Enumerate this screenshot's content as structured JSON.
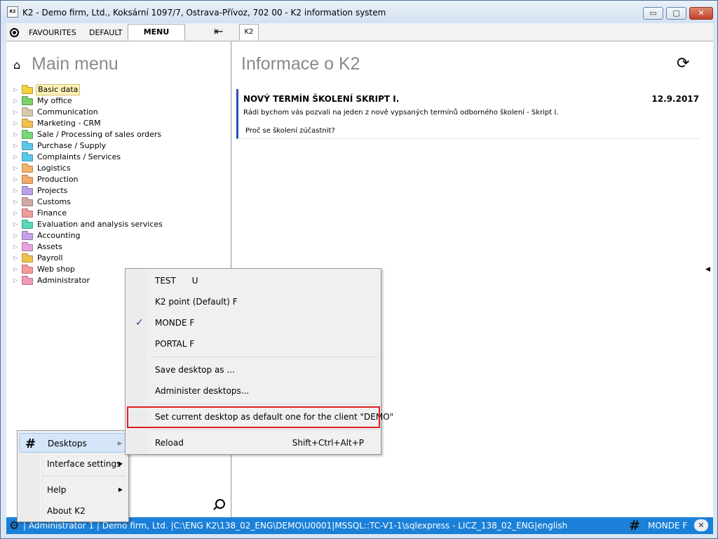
{
  "window": {
    "icon_text": "K2",
    "title": "K2 - Demo firm, Ltd., Koksární 1097/7, Ostrava-Přívoz, 702 00 - K2 information system",
    "min": "▭",
    "max": "▢",
    "close": "✕"
  },
  "tabs": {
    "favourites": "FAVOURITES",
    "default": "DEFAULT",
    "menu": "MENU",
    "collapse": "⇤",
    "k2": "K2"
  },
  "left": {
    "title": "Main menu",
    "home": "⌂",
    "tree": [
      {
        "label": "Basic data",
        "color": "#f5d33e"
      },
      {
        "label": "My office",
        "color": "#7ed16b"
      },
      {
        "label": "Communication",
        "color": "#d9c8b0"
      },
      {
        "label": "Marketing - CRM",
        "color": "#f2c24f"
      },
      {
        "label": "Sale / Processing of sales orders",
        "color": "#79d879"
      },
      {
        "label": "Purchase / Supply",
        "color": "#5cc8ea"
      },
      {
        "label": "Complaints / Services",
        "color": "#5cc8ea"
      },
      {
        "label": "Logistics",
        "color": "#f2b36b"
      },
      {
        "label": "Production",
        "color": "#f3a86a"
      },
      {
        "label": "Projects",
        "color": "#b9a2e8"
      },
      {
        "label": "Customs",
        "color": "#d1aaa5"
      },
      {
        "label": "Finance",
        "color": "#f09a9a"
      },
      {
        "label": "Evaluation and analysis services",
        "color": "#5ad6b8"
      },
      {
        "label": "Accounting",
        "color": "#c4a3e8"
      },
      {
        "label": "Assets",
        "color": "#e7a3e0"
      },
      {
        "label": "Payroll",
        "color": "#f2c24f"
      },
      {
        "label": "Web shop",
        "color": "#f59a9a"
      },
      {
        "label": "Administrator",
        "color": "#f09ab8"
      }
    ]
  },
  "right": {
    "title": "Informace o K2",
    "refresh": "⟳",
    "news": {
      "title": "NOVÝ TERMÍN ŠKOLENÍ SKRIPT I.",
      "date": "12.9.2017",
      "text": "Rádi bychom vás pozvali na jeden z nově vypsaných termínů odborného školení - Skript I.",
      "link": "Proč se školení zúčastnit?"
    },
    "side_arrow": "◀"
  },
  "context_menu": {
    "desktops": "Desktops",
    "interface_settings": "Interface settings",
    "help": "Help",
    "about": "About K2",
    "arrow": "▶",
    "hash": "#"
  },
  "desktops_menu": {
    "items": [
      {
        "label": "TEST      U"
      },
      {
        "label": "K2 point (Default) F"
      },
      {
        "label": "MONDE F",
        "checked": true
      },
      {
        "label": "PORTAL F"
      }
    ],
    "check": "✓",
    "save": "Save desktop as ...",
    "administer": "Administer desktops...",
    "set_default": "Set current desktop as default one for the client \"DEMO\"",
    "reload": "Reload",
    "reload_shortcut": "Shift+Ctrl+Alt+P"
  },
  "status": {
    "gear": "⚙",
    "text": "| Administrator 1 | Demo firm, Ltd. |C:\\ENG K2\\138_02_ENG\\DEMO\\U0001|MSSQL::TC-V1-1\\sqlexpress - LICZ_138_02_ENG|english",
    "hash": "#",
    "desktop": "MONDE F",
    "close": "✕"
  }
}
